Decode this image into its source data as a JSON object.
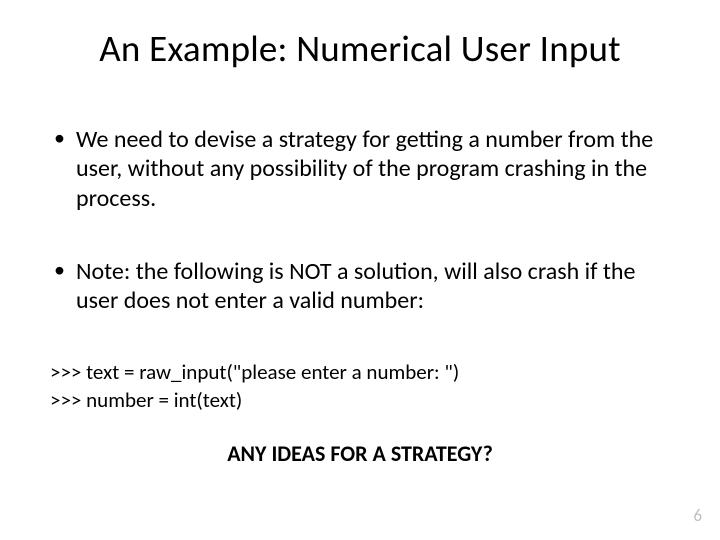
{
  "title": "An Example: Numerical User Input",
  "bullets": [
    "We need to devise a strategy for getting a number from the user, without any possibility of the program crashing in the process.",
    "Note: the following is NOT a solution, will also crash if the user does not enter a valid number:"
  ],
  "code": {
    "line1": ">>> text = raw_input(\"please enter a number: \")",
    "line2": ">>> number = int(text)"
  },
  "prompt": "ANY IDEAS FOR A STRATEGY?",
  "page_number": "6"
}
